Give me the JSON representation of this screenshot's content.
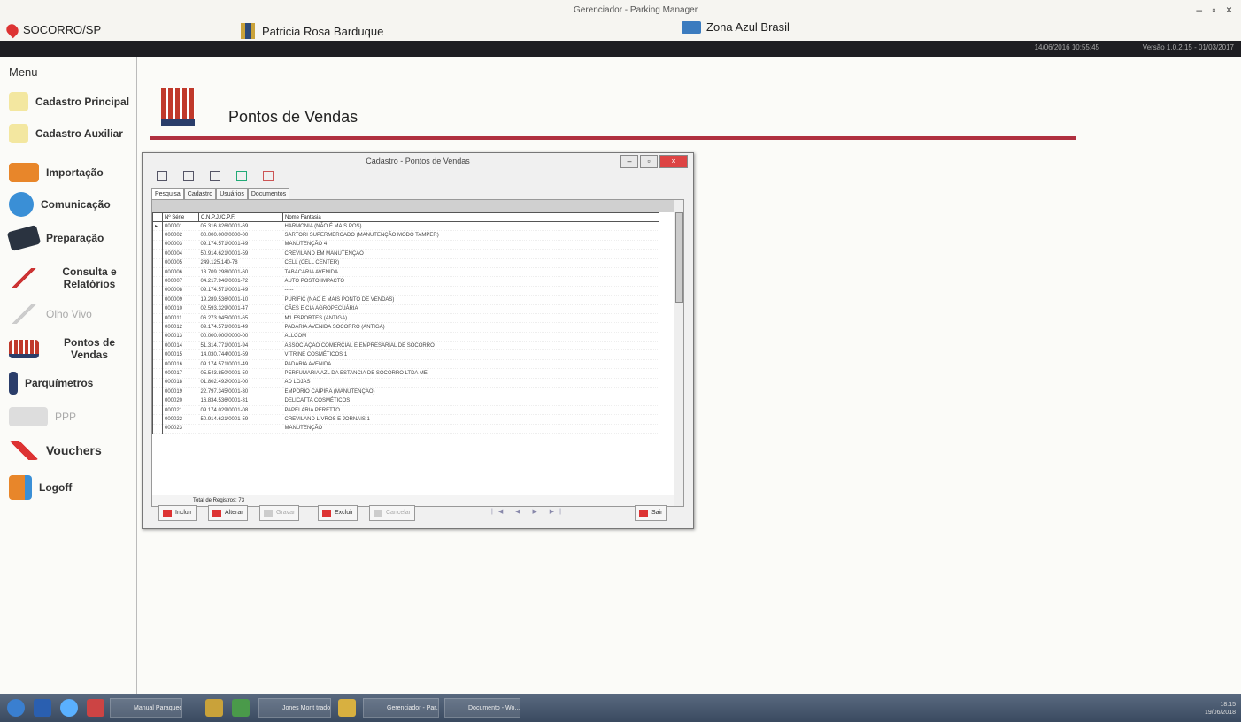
{
  "window": {
    "title": "Gerenciador - Parking Manager",
    "controls": "– ▫ ×"
  },
  "header": {
    "city": "SOCORRO/SP",
    "user": "Patricia Rosa Barduque",
    "company": "Zona Azul Brasil",
    "datetime": "14/06/2016 10:55:45",
    "version": "Versão 1.0.2.15 - 01/03/2017"
  },
  "sidebar": {
    "title": "Menu",
    "items": [
      {
        "label": "Cadastro Principal",
        "icon": "star-icon"
      },
      {
        "label": "Cadastro Auxiliar",
        "icon": "star-icon"
      },
      {
        "label": "Importação",
        "icon": "folder-icon"
      },
      {
        "label": "Comunicação",
        "icon": "globe-icon"
      },
      {
        "label": "Preparação",
        "icon": "book-icon"
      },
      {
        "label": "Consulta e Relatórios",
        "icon": "chart-icon"
      },
      {
        "label": "Olho Vivo",
        "icon": "eye-icon"
      },
      {
        "label": "Pontos de Vendas",
        "icon": "store-icon"
      },
      {
        "label": "Parquímetros",
        "icon": "parking-meter-icon"
      },
      {
        "label": "PPP",
        "icon": "device-icon"
      },
      {
        "label": "Vouchers",
        "icon": "voucher-icon"
      },
      {
        "label": "Logoff",
        "icon": "logout-icon"
      }
    ]
  },
  "page": {
    "title": "Pontos de Vendas"
  },
  "dialog": {
    "title": "Cadastro - Pontos de Vendas",
    "tabs": [
      "Pesquisa",
      "Cadastro",
      "Usuários",
      "Documentos"
    ],
    "columns": [
      "Nº Série",
      "C.N.P.J./C.P.F.",
      "Nome Fantasia"
    ],
    "rows": [
      [
        "000001",
        "05.316.826/0001-69",
        "HARMONIA (NÃO É MAIS POS)"
      ],
      [
        "000002",
        "00.000.000/0000-00",
        "SARTORI SUPERMERCADO (MANUTENÇÃO MODO TAMPER)"
      ],
      [
        "000003",
        "09.174.571/0001-49",
        "MANUTENÇÃO 4"
      ],
      [
        "000004",
        "50.914.621/0001-59",
        "CREVILAND EM MANUTENÇÃO"
      ],
      [
        "000005",
        "249.125.140-78",
        "CELL (CELL CENTER)"
      ],
      [
        "000006",
        "13.709.298/0001-60",
        "TABACARIA AVENIDA"
      ],
      [
        "000007",
        "04.217.946/0001-72",
        "AUTO POSTO IMPACTO"
      ],
      [
        "000008",
        "09.174.571/0001-49",
        "-----"
      ],
      [
        "000009",
        "19.289.536/0001-10",
        "PURIFIC (NÃO É MAIS PONTO DE VENDAS)"
      ],
      [
        "000010",
        "02.593.329/0001-47",
        "CÃES E CIA AGROPECUÁRIA"
      ],
      [
        "000011",
        "06.273.945/0001-65",
        "M1 ESPORTES (ANTIGA)"
      ],
      [
        "000012",
        "09.174.571/0001-49",
        "PADARIA AVENIDA SOCORRO (ANTIGA)"
      ],
      [
        "000013",
        "00.000.000/0000-00",
        "ALLCOM"
      ],
      [
        "000014",
        "51.314.771/0001-94",
        "ASSOCIAÇÃO COMERCIAL E EMPRESARIAL DE SOCORRO"
      ],
      [
        "000015",
        "14.030.744/0001-59",
        "VITRINE COSMÉTICOS 1"
      ],
      [
        "000016",
        "09.174.571/0001-49",
        "PADARIA AVENIDA"
      ],
      [
        "000017",
        "05.543.850/0001-50",
        "PERFUMARIA AZL DA ESTANCIA DE SOCORRO LTDA ME"
      ],
      [
        "000018",
        "01.802.492/0001-00",
        "AD LOJAS"
      ],
      [
        "000019",
        "22.797.345/0001-30",
        "EMPORIO CAIPIRA (MANUTENÇÃO)"
      ],
      [
        "000020",
        "16.834.536/0001-31",
        "DELICATTA COSMÉTICOS"
      ],
      [
        "000021",
        "09.174.029/0001-08",
        "PAPELARIA PERETTO"
      ],
      [
        "000022",
        "50.914.621/0001-59",
        "CREVILAND LIVROS E JORNAIS 1"
      ],
      [
        "000023",
        "",
        "MANUTENÇÃO"
      ]
    ],
    "total_label": "Total de Registros: 73",
    "buttons": {
      "incluir": "Incluir",
      "alterar": "Alterar",
      "gravar": "Gravar",
      "excluir": "Excluir",
      "cancelar": "Cancelar",
      "sair": "Sair"
    },
    "nav": "|◀ ◀ ▶ ▶|"
  },
  "taskbar": {
    "items": [
      "Manual Paraqueo...",
      "Jones Mont trado...",
      "Gerenciador - Par...",
      "Documento - Wo..."
    ],
    "time": "18:15",
    "date": "19/06/2018"
  },
  "colors": {
    "accent_rule": "#b03040",
    "darkbar": "#1e1e22",
    "taskbar": "#4a5a70"
  }
}
